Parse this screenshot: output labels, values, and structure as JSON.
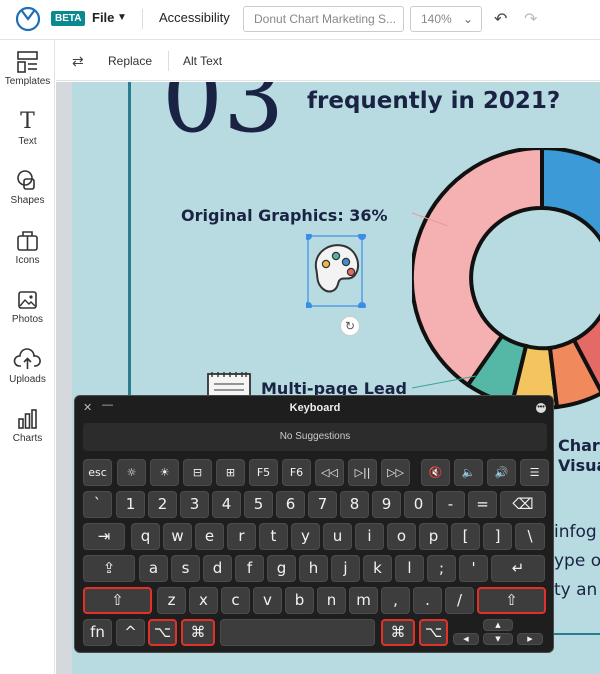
{
  "app": {
    "beta_badge": "BETA",
    "file_menu": "File",
    "accessibility": "Accessibility",
    "doc_title": "Donut Chart Marketing S...",
    "zoom": "140%"
  },
  "sidebar": {
    "items": [
      {
        "label": "Templates",
        "icon": "templates-icon"
      },
      {
        "label": "Text",
        "icon": "text-icon"
      },
      {
        "label": "Shapes",
        "icon": "shapes-icon"
      },
      {
        "label": "Icons",
        "icon": "icons-icon"
      },
      {
        "label": "Photos",
        "icon": "photos-icon"
      },
      {
        "label": "Uploads",
        "icon": "uploads-icon"
      },
      {
        "label": "Charts",
        "icon": "charts-icon"
      }
    ]
  },
  "subbar": {
    "replace": "Replace",
    "alt_text": "Alt Text"
  },
  "canvas": {
    "big_number": "03",
    "question": "frequently in 2021?",
    "label_original": "Original Graphics: 36%",
    "label_multi": "Multi-page Lead",
    "label_charts_1": "Char",
    "label_charts_2": "Visua",
    "body_1": "infog",
    "body_2": "ype o",
    "body_3": "ty an"
  },
  "keyboard": {
    "title": "Keyboard",
    "suggestions": "No Suggestions",
    "rows": [
      [
        "esc",
        "☼",
        "☀",
        "⊟",
        "⊞",
        "F5",
        "F6",
        "◁◁",
        "▷||",
        "▷▷",
        "🔇",
        "🔈",
        "🔊",
        "☰"
      ],
      [
        "`",
        "1",
        "2",
        "3",
        "4",
        "5",
        "6",
        "7",
        "8",
        "9",
        "0",
        "-",
        "=",
        "⌫"
      ],
      [
        "⇥",
        "q",
        "w",
        "e",
        "r",
        "t",
        "y",
        "u",
        "i",
        "o",
        "p",
        "[",
        "]",
        "\\"
      ],
      [
        "⇪",
        "a",
        "s",
        "d",
        "f",
        "g",
        "h",
        "j",
        "k",
        "l",
        ";",
        "'",
        "↵"
      ],
      [
        "⇧",
        "z",
        "x",
        "c",
        "v",
        "b",
        "n",
        "m",
        ",",
        ".",
        "/",
        "⇧"
      ],
      [
        "fn",
        "^",
        "⌥",
        "⌘",
        " ",
        "⌘",
        "⌥",
        "◀",
        "▲",
        "▼",
        "▶"
      ]
    ]
  },
  "colors": {
    "accent": "#0a8a8f",
    "highlight": "#e0322a",
    "canvas_bg": "#b8dbe1",
    "navy": "#1a2344"
  }
}
